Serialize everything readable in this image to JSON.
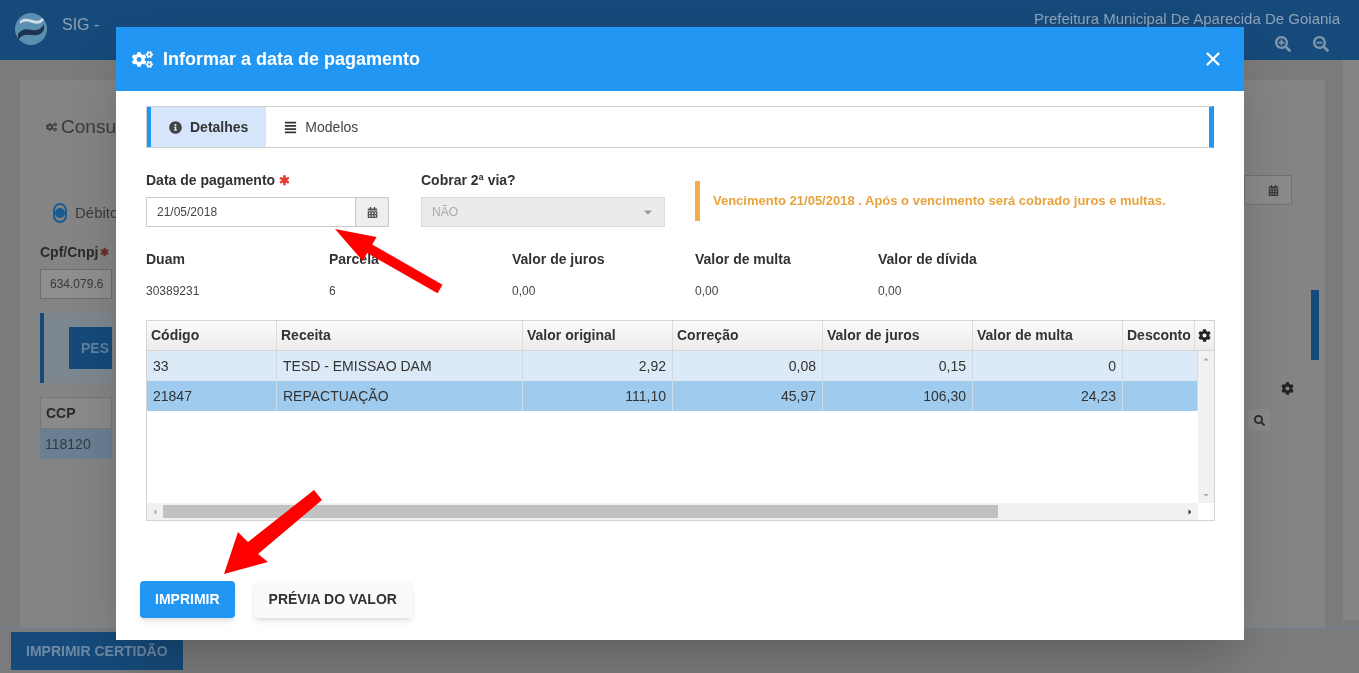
{
  "app_header": {
    "title": "SIG -",
    "organization": "Prefeitura Municipal De Aparecida De Goiania"
  },
  "background": {
    "heading": "Consu",
    "radio": {
      "label": "Débito",
      "selected": true
    },
    "cpf": {
      "label": "Cpf/Cnpj",
      "required_mark": "✱",
      "value": "634.079.6"
    },
    "search_button": "PES",
    "table": {
      "column": "CCP",
      "row": {
        "cell": "118120",
        "selected": true
      }
    },
    "print_button": "IMPRIMIR CERTIDÃO"
  },
  "dialog": {
    "title": "Informar a data de pagamento",
    "tabs": [
      {
        "label": "Detalhes",
        "selected": true
      },
      {
        "label": "Modelos",
        "selected": false
      }
    ],
    "payment_date": {
      "label": "Data de pagamento",
      "required_mark": "✱",
      "value": "21/05/2018"
    },
    "second_copy": {
      "label": "Cobrar 2ª via?",
      "value": "NÃO",
      "disabled": true
    },
    "alert": "Vencimento 21/05/2018 . Após o vencimento será cobrado juros e multas.",
    "summary": [
      {
        "label": "Duam",
        "value": "30389231"
      },
      {
        "label": "Parcela",
        "value": "6"
      },
      {
        "label": "Valor de juros",
        "value": "0,00"
      },
      {
        "label": "Valor de multa",
        "value": "0,00"
      },
      {
        "label": "Valor de dívida",
        "value": "0,00"
      }
    ],
    "table": {
      "columns": [
        "Código",
        "Receita",
        "Valor original",
        "Correção",
        "Valor de juros",
        "Valor de multa",
        "Desconto"
      ],
      "rows": [
        {
          "selected": false,
          "cells": [
            "33",
            "TESD - EMISSAO DAM",
            "2,92",
            "0,08",
            "0,15",
            "0"
          ]
        },
        {
          "selected": true,
          "cells": [
            "21847",
            "REPACTUAÇÃO",
            "111,10",
            "45,97",
            "106,30",
            "24,23"
          ]
        }
      ]
    },
    "buttons": [
      {
        "label": "IMPRIMIR",
        "kind": "primary"
      },
      {
        "label": "PRÉVIA DO VALOR",
        "kind": "default"
      }
    ]
  }
}
